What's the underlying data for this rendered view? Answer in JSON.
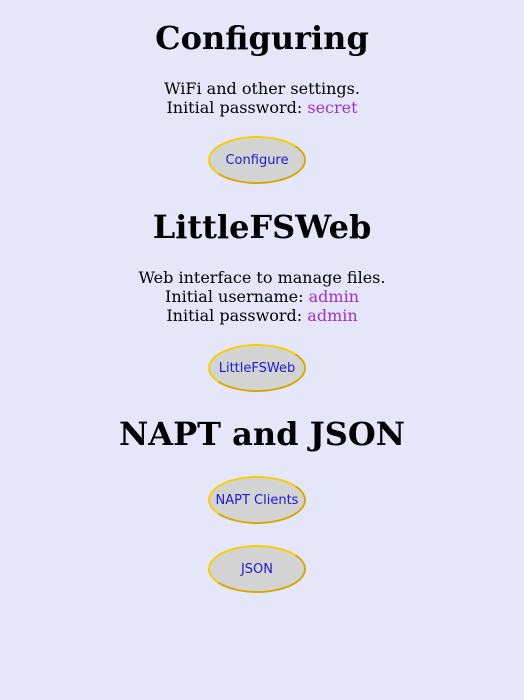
{
  "configuring": {
    "title": "Configuring",
    "description": "WiFi and other settings.",
    "password_label": "Initial password: ",
    "password_value": "secret",
    "button_label": "Configure"
  },
  "littlefsweb": {
    "title": "LittleFSWeb",
    "description": "Web interface to manage files.",
    "username_label": "Initial username: ",
    "username_value": "admin",
    "password_label": "Initial password: ",
    "password_value": "admin",
    "button_label": "LittleFSWeb"
  },
  "napt_json": {
    "title": "NAPT and JSON",
    "napt_button_label": "NAPT Clients",
    "json_button_label": "JSON"
  },
  "colors": {
    "background": "#e6e6fa",
    "value_text": "#9b30d9",
    "button_fill": "#d3d3d3",
    "button_border": "#d4a900",
    "button_text": "#1a1ad6"
  }
}
